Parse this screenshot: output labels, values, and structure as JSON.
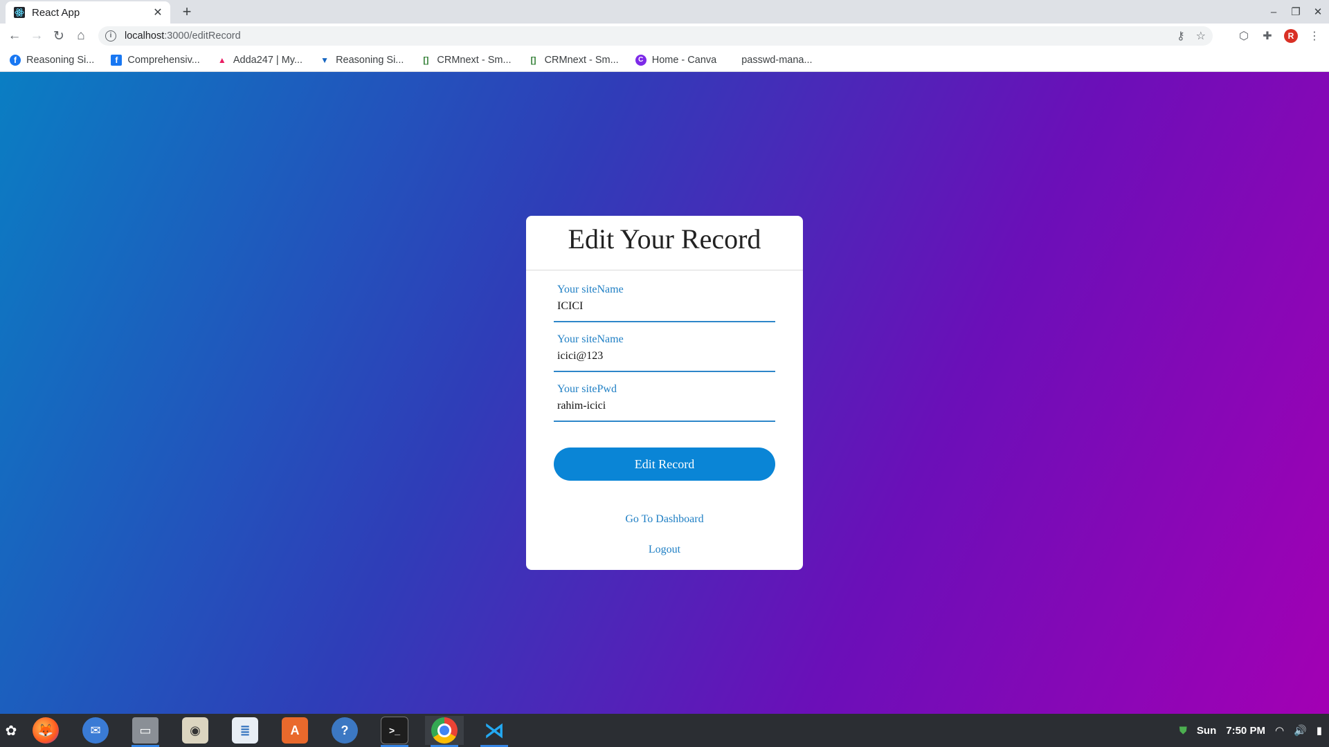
{
  "browser": {
    "tab_title": "React App",
    "url_host": "localhost",
    "url_path": ":3000/editRecord",
    "profile_initial": "R"
  },
  "bookmarks": [
    {
      "label": "Reasoning Si...",
      "icon": "facebook-icon",
      "color": "#1877f2"
    },
    {
      "label": "Comprehensiv...",
      "icon": "facebook-icon",
      "color": "#1877f2"
    },
    {
      "label": "Adda247 | My...",
      "icon": "adda-icon",
      "color": "#e91e63"
    },
    {
      "label": "Reasoning Si...",
      "icon": "bookmark-icon",
      "color": "#1565c0"
    },
    {
      "label": "CRMnext - Sm...",
      "icon": "crmnext-icon",
      "color": "#2e7d32"
    },
    {
      "label": "CRMnext - Sm...",
      "icon": "crmnext-icon",
      "color": "#2e7d32"
    },
    {
      "label": "Home - Canva",
      "icon": "canva-icon",
      "color": "#7d2ae8"
    },
    {
      "label": "passwd-mana...",
      "icon": "",
      "color": ""
    }
  ],
  "card": {
    "title": "Edit Your Record",
    "fields": [
      {
        "label": "Your siteName",
        "value": "ICICI"
      },
      {
        "label": "Your siteName",
        "value": "icici@123"
      },
      {
        "label": "Your sitePwd",
        "value": "rahim-icici"
      }
    ],
    "submit_label": "Edit Record",
    "dashboard_link": "Go To Dashboard",
    "logout_link": "Logout"
  },
  "taskbar": {
    "apps": [
      "launcher-icon",
      "firefox-icon",
      "thunderbird-icon",
      "files-icon",
      "rhythmbox-icon",
      "writer-icon",
      "software-center-icon",
      "help-icon",
      "terminal-icon",
      "chrome-icon",
      "vscode-icon"
    ],
    "day": "Sun",
    "time": "7:50 PM"
  },
  "colors": {
    "accent": "#0a85d6",
    "label": "#1f7fc4",
    "gradient_start": "#0a7ec3",
    "gradient_end": "#a300b4"
  }
}
